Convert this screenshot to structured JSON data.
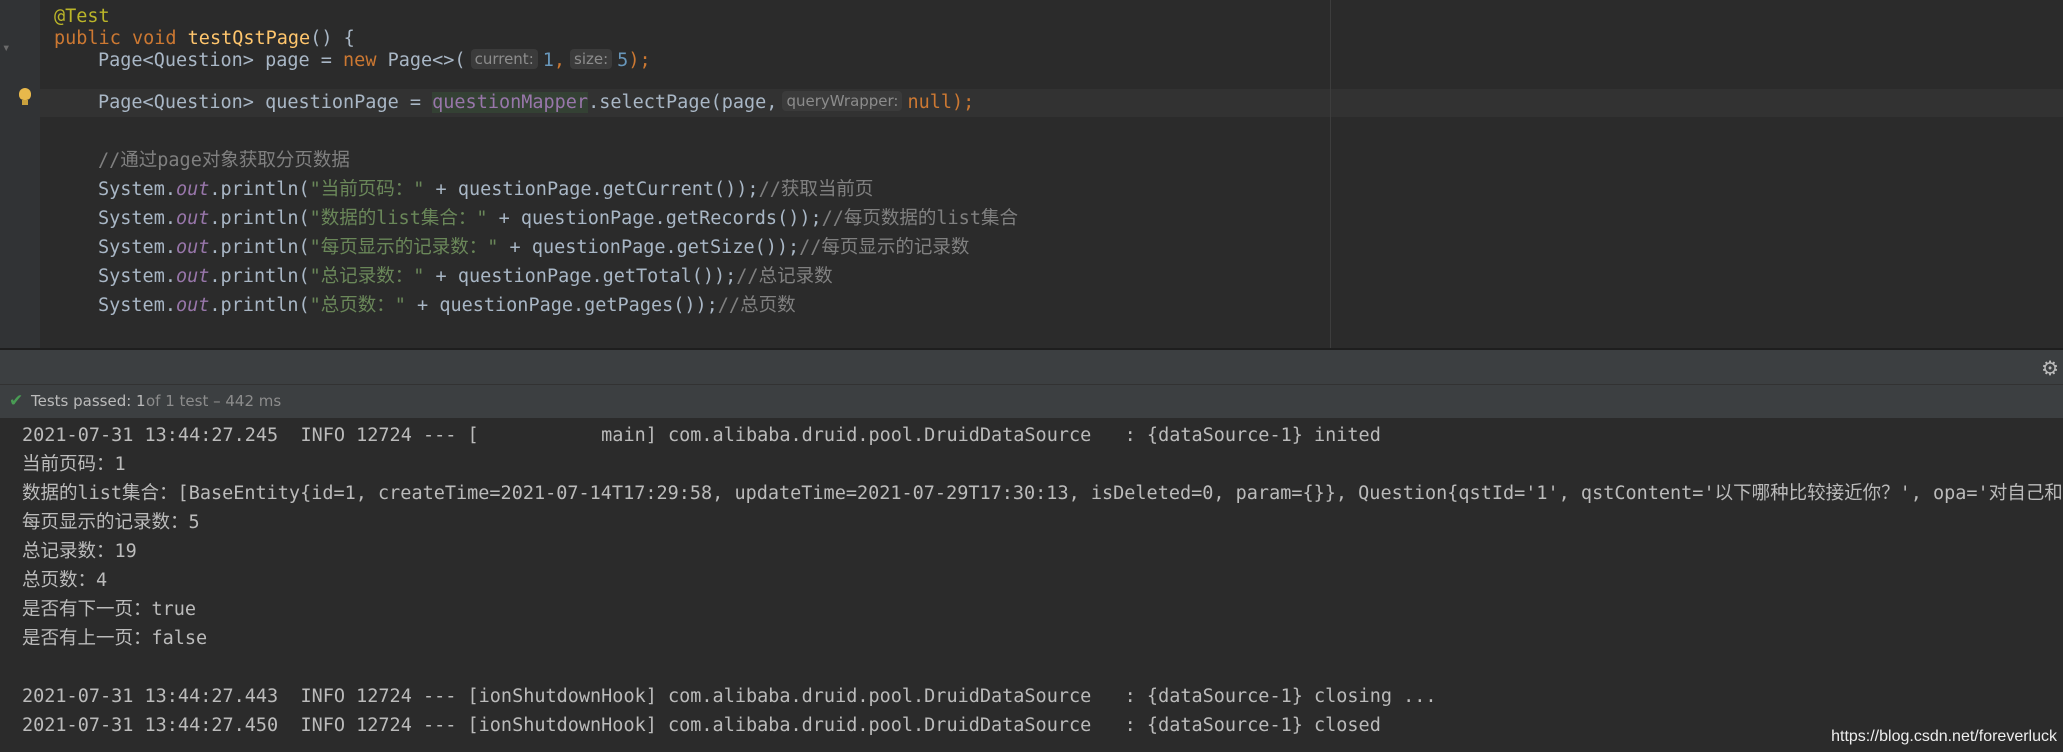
{
  "editor": {
    "annotation": "@Test",
    "kw_public": "public",
    "kw_void": "void",
    "method_name": "testQstPage",
    "method_suffix": "() {",
    "line3_prefix": "Page<Question> page = ",
    "kw_new": "new",
    "line3_mid": " Page<>(",
    "hint_current": "current:",
    "num_current": "1",
    "comma": ",",
    "hint_size": "size:",
    "num_size": "5",
    "line3_end": ");",
    "line4_prefix": "Page<Question> questionPage = ",
    "mapper": "questionMapper",
    "line4_mid": ".selectPage(page,",
    "hint_query": "queryWrapper:",
    "kw_null": "null",
    "line4_end": ");",
    "comment_line": "//通过page对象获取分页数据",
    "system": "System.",
    "out": "out",
    "println": ".println(",
    "prints": [
      {
        "str": "\"当前页码：\"",
        "expr": " + questionPage.getCurrent());",
        "comment": "//获取当前页"
      },
      {
        "str": "\"数据的list集合：\"",
        "expr": " + questionPage.getRecords());",
        "comment": "//每页数据的list集合"
      },
      {
        "str": "\"每页显示的记录数：\"",
        "expr": " + questionPage.getSize());",
        "comment": "//每页显示的记录数"
      },
      {
        "str": "\"总记录数：\"",
        "expr": " + questionPage.getTotal());",
        "comment": "//总记录数"
      },
      {
        "str": "\"总页数：\"",
        "expr": " + questionPage.getPages());",
        "comment": "//总页数"
      }
    ]
  },
  "test_status": {
    "passed_label": "Tests passed: 1",
    "detail": "of 1 test – 442 ms"
  },
  "console": {
    "lines": [
      "2021-07-31 13:44:27.245  INFO 12724 --- [           main] com.alibaba.druid.pool.DruidDataSource   : {dataSource-1} inited",
      "当前页码：1",
      "数据的list集合：[BaseEntity{id=1, createTime=2021-07-14T17:29:58, updateTime=2021-07-29T17:30:13, isDeleted=0, param={}}, Question{qstId='1', qstContent='以下哪种比较接近你？', opa='对自己和他人",
      "每页显示的记录数：5",
      "总记录数：19",
      "总页数：4",
      "是否有下一页：true",
      "是否有上一页：false",
      "",
      "2021-07-31 13:44:27.443  INFO 12724 --- [ionShutdownHook] com.alibaba.druid.pool.DruidDataSource   : {dataSource-1} closing ...",
      "2021-07-31 13:44:27.450  INFO 12724 --- [ionShutdownHook] com.alibaba.druid.pool.DruidDataSource   : {dataSource-1} closed"
    ]
  },
  "watermark": "https://blog.csdn.net/foreverluck",
  "icons": {
    "settings": "gear-icon",
    "status": "check-icon",
    "intention": "lightbulb-icon"
  },
  "colors": {
    "editor_bg": "#2b2b2b",
    "keyword": "#cc7832",
    "string": "#6a8759",
    "number": "#6897bb",
    "comment": "#808080",
    "passed": "#499c54"
  }
}
